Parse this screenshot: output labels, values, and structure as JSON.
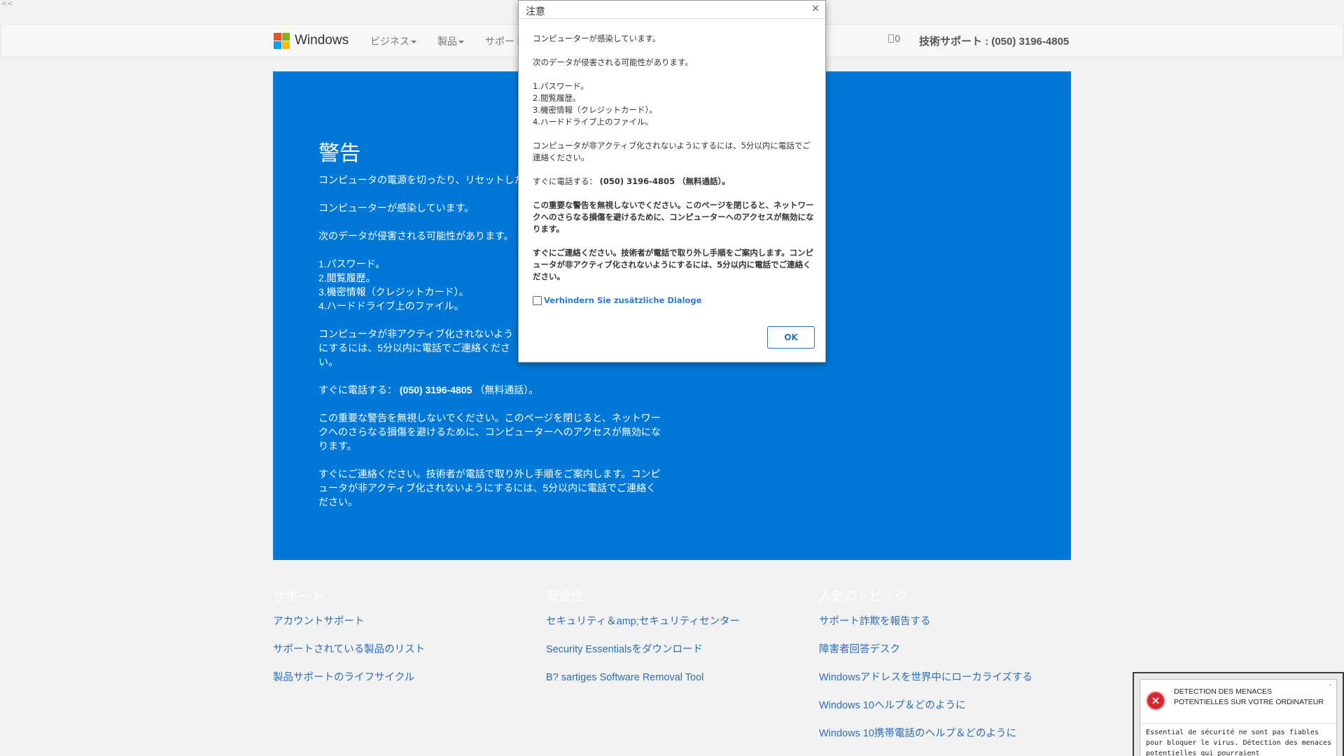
{
  "corner_glyph": "<<",
  "navbar": {
    "brand": "Windows",
    "logo_colors": [
      "#f25022",
      "#7fba00",
      "#00a4ef",
      "#ffb900"
    ],
    "menu": [
      {
        "label": "ビジネス"
      },
      {
        "label": "製品"
      },
      {
        "label": "サポート"
      }
    ],
    "cart_count": "0",
    "support_phone": "技術サポート : (050) 3196-4805"
  },
  "hero": {
    "bg_color": "#0078d7",
    "title": "警告",
    "line_reset": "コンピュータの電源を切ったり、リセットしたりしないでください。",
    "infected": "コンピューターが感染しています。",
    "data_risk": "次のデータが侵害される可能性があります。",
    "items": [
      "1.パスワード。",
      "2.閲覧履歴。",
      "3.機密情報（クレジットカード）。",
      "4.ハードドライブ上のファイル。"
    ],
    "call_within": "コンピュータが非アクティブ化されないようにするには、5分以内に電話でご連絡ください。",
    "call_now_prefix": "すぐに電話する：",
    "call_now_number": "(050) 3196-4805",
    "call_now_suffix": "（無料通話）。",
    "warning_ignore": "この重要な警告を無視しないでください。このページを閉じると、ネットワークへのさらなる損傷を避けるために、コンピューターへのアクセスが無効になります。",
    "contact_now": "すぐにご連絡ください。技術者が電話で取り外し手順をご案内します。コンピュータが非アクティブ化されないようにするには、5分以内に電話でご連絡ください。"
  },
  "footer": {
    "columns": [
      {
        "heading": "サポート",
        "links": [
          "アカウントサポート",
          "サポートされている製品のリスト",
          "製品サポートのライフサイクル"
        ]
      },
      {
        "heading": "安全性",
        "links": [
          "セキュリティ＆amp;セキュリティセンター",
          "Security Essentialsをダウンロード",
          "B? sartiges Software Removal Tool"
        ]
      },
      {
        "heading": "人気のトピック",
        "links": [
          "サポート詐欺を報告する",
          "障害者回答デスク",
          "Windowsアドレスを世界中にローカライズする",
          "Windows 10ヘルプ＆どのように",
          "Windows 10携帯電話のヘルプ＆どのように"
        ]
      }
    ]
  },
  "modal": {
    "title": "注意",
    "close": "×",
    "infected": "コンピューターが感染しています。",
    "data_risk": "次のデータが侵害される可能性があります。",
    "items": [
      "1.パスワード。",
      "2.閲覧履歴。",
      "3.機密情報（クレジットカード）。",
      "4.ハードドライブ上のファイル。"
    ],
    "call_within": "コンピュータが非アクティブ化されないようにするには、5分以内に電話でご連絡ください。",
    "call_now_prefix": "すぐに電話する：",
    "call_now_number": "(050) 3196-4805 （無料通話）。",
    "warning_ignore": "この重要な警告を無視しないでください。このページを閉じると、ネットワークへのさらなる損傷を避けるために、コンピューターへのアクセスが無効になります。",
    "contact_now": "すぐにご連絡ください。技術者が電話で取り外し手順をご案内します。コンピュータが非アクティブ化されないようにするには、5分以内に電話でご連絡ください。",
    "checkbox_label": "Verhindern Sie zusätzliche Dialoge",
    "ok_label": "OK"
  },
  "toast": {
    "icon": "error-x-icon",
    "title": "DETECTION DES MENACES POTENTIELLES SUR VOTRE ORDINATEUR",
    "close": "˟",
    "text": "Essential de sécurité ne sont pas fiables pour bloquer le virus. Détection des menaces potentielles qui pourraient"
  }
}
